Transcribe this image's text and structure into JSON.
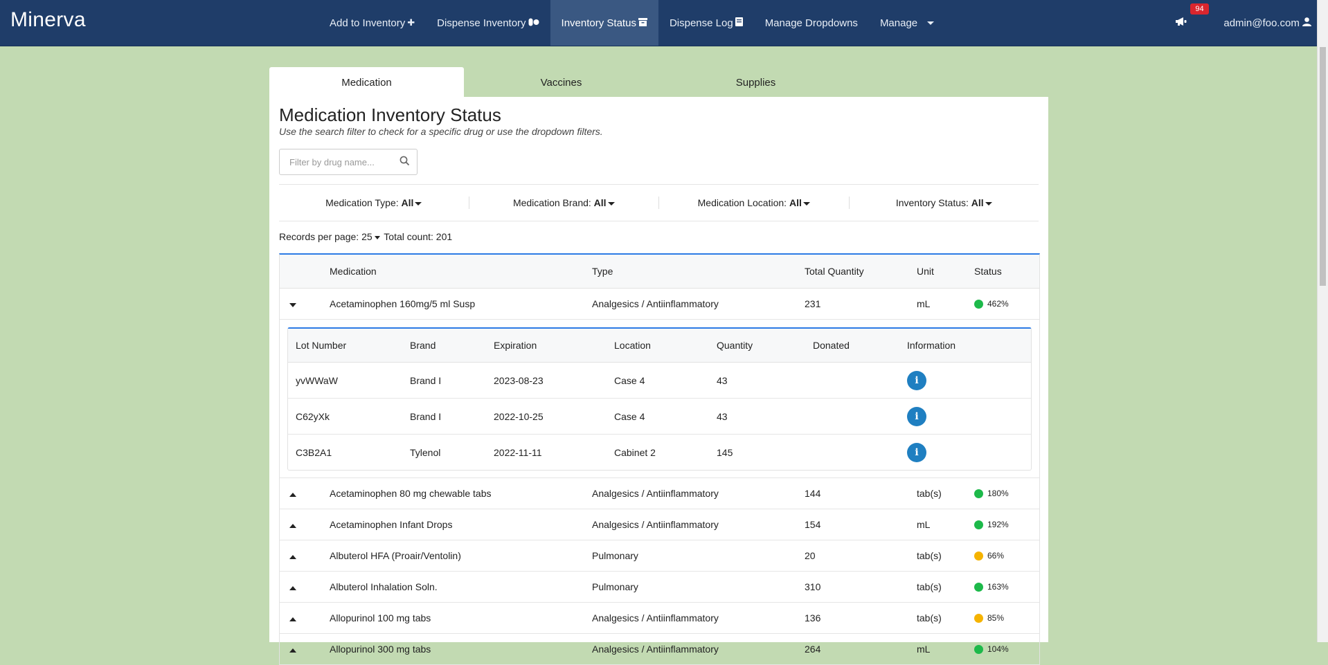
{
  "nav": {
    "brand": "Minerva",
    "links": [
      {
        "label": "Add to Inventory",
        "icon": "plus-icon"
      },
      {
        "label": "Dispense Inventory",
        "icon": "pills-icon"
      },
      {
        "label": "Inventory Status",
        "icon": "archive-icon"
      },
      {
        "label": "Dispense Log",
        "icon": "book-icon"
      },
      {
        "label": "Manage Dropdowns"
      },
      {
        "label": "Manage"
      }
    ],
    "notification_count": "94",
    "user": "admin@foo.com"
  },
  "tabs": [
    "Medication",
    "Vaccines",
    "Supplies"
  ],
  "page": {
    "title": "Medication Inventory Status",
    "subtitle": "Use the search filter to check for a specific drug or use the dropdown filters.",
    "search_placeholder": "Filter by drug name..."
  },
  "filters": [
    {
      "label": "Medication Type:",
      "value": "All"
    },
    {
      "label": "Medication Brand:",
      "value": "All"
    },
    {
      "label": "Medication Location:",
      "value": "All"
    },
    {
      "label": "Inventory Status:",
      "value": "All"
    }
  ],
  "records": {
    "label": "Records per page:",
    "per_page": "25",
    "total_label": "Total count:",
    "total": "201"
  },
  "table": {
    "headers": [
      "Medication",
      "Type",
      "Total Quantity",
      "Unit",
      "Status"
    ],
    "rows": [
      {
        "medication": "Acetaminophen 160mg/5 ml Susp",
        "type": "Analgesics / Antiinflammatory",
        "qty": "231",
        "unit": "mL",
        "status": "462%",
        "color": "#1db94a",
        "expanded": true
      },
      {
        "medication": "Acetaminophen 80 mg chewable tabs",
        "type": "Analgesics / Antiinflammatory",
        "qty": "144",
        "unit": "tab(s)",
        "status": "180%",
        "color": "#1db94a"
      },
      {
        "medication": "Acetaminophen Infant Drops",
        "type": "Analgesics / Antiinflammatory",
        "qty": "154",
        "unit": "mL",
        "status": "192%",
        "color": "#1db94a"
      },
      {
        "medication": "Albuterol HFA (Proair/Ventolin)",
        "type": "Pulmonary",
        "qty": "20",
        "unit": "tab(s)",
        "status": "66%",
        "color": "#f5b300"
      },
      {
        "medication": "Albuterol Inhalation Soln.",
        "type": "Pulmonary",
        "qty": "310",
        "unit": "tab(s)",
        "status": "163%",
        "color": "#1db94a"
      },
      {
        "medication": "Allopurinol 100 mg tabs",
        "type": "Analgesics / Antiinflammatory",
        "qty": "136",
        "unit": "tab(s)",
        "status": "85%",
        "color": "#f5b300"
      },
      {
        "medication": "Allopurinol 300 mg tabs",
        "type": "Analgesics / Antiinflammatory",
        "qty": "264",
        "unit": "mL",
        "status": "104%",
        "color": "#1db94a"
      }
    ]
  },
  "lots": {
    "headers": [
      "Lot Number",
      "Brand",
      "Expiration",
      "Location",
      "Quantity",
      "Donated",
      "Information"
    ],
    "rows": [
      {
        "lot": "yvWWaW",
        "brand": "Brand I",
        "expiration": "2023-08-23",
        "location": "Case 4",
        "quantity": "43",
        "donated": ""
      },
      {
        "lot": "C62yXk",
        "brand": "Brand I",
        "expiration": "2022-10-25",
        "location": "Case 4",
        "quantity": "43",
        "donated": ""
      },
      {
        "lot": "C3B2A1",
        "brand": "Tylenol",
        "expiration": "2022-11-11",
        "location": "Cabinet 2",
        "quantity": "145",
        "donated": ""
      }
    ]
  }
}
